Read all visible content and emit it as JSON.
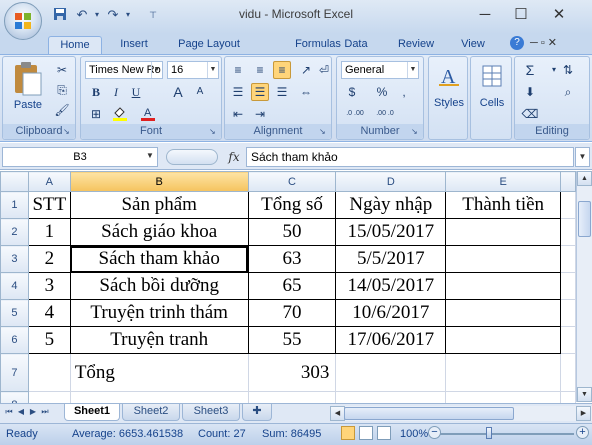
{
  "window": {
    "title": "vidu - Microsoft Excel",
    "minimize_glyph": "─",
    "maximize_glyph": "☐",
    "close_glyph": "✕"
  },
  "qat": {
    "save_icon": "save-icon",
    "undo_icon": "undo-icon",
    "redo_icon": "redo-icon",
    "customize_icon": "chevron-down-icon"
  },
  "tabs": [
    "Home",
    "Insert",
    "Page Layout",
    "Formulas",
    "Data",
    "Review",
    "View"
  ],
  "ribbon": {
    "clipboard": {
      "label": "Clipboard",
      "paste": "Paste"
    },
    "font": {
      "label": "Font",
      "name": "Times New Ro",
      "size": "16",
      "bold": "B",
      "italic": "I",
      "underline": "U",
      "grow": "A",
      "shrink": "A"
    },
    "alignment": {
      "label": "Alignment"
    },
    "number": {
      "label": "Number",
      "format": "General",
      "currency": "$",
      "percent": "%",
      "comma": ",",
      "dec_inc": ".0 .00",
      "dec_dec": ".00 .0"
    },
    "styles": {
      "label": "Styles"
    },
    "cells": {
      "label": "Cells"
    },
    "editing": {
      "label": "Editing",
      "sum": "Σ"
    }
  },
  "formula_bar": {
    "name_box": "B3",
    "fx": "fx",
    "formula": "Sách tham khảo"
  },
  "sheet": {
    "columns": [
      "A",
      "B",
      "C",
      "D",
      "E"
    ],
    "selected_column": "B",
    "row_numbers": [
      "1",
      "2",
      "3",
      "4",
      "5",
      "6",
      "7",
      "8"
    ],
    "header": [
      "STT",
      "Sản phẩm",
      "Tổng số",
      "Ngày nhập",
      "Thành tiền"
    ],
    "rows": [
      [
        "1",
        "Sách giáo khoa",
        "50",
        "15/05/2017",
        ""
      ],
      [
        "2",
        "Sách tham khảo",
        "63",
        "5/5/2017",
        ""
      ],
      [
        "3",
        "Sách bồi dưỡng",
        "65",
        "14/05/2017",
        ""
      ],
      [
        "4",
        "Truyện trinh thám",
        "70",
        "10/6/2017",
        ""
      ],
      [
        "5",
        "Truyện tranh",
        "55",
        "17/06/2017",
        ""
      ]
    ],
    "total_label": "Tổng",
    "total_value": "303",
    "active_cell": "B3"
  },
  "sheet_tabs": [
    "Sheet1",
    "Sheet2",
    "Sheet3"
  ],
  "active_sheet": "Sheet1",
  "status": {
    "mode": "Ready",
    "average": "Average: 6653.461538",
    "count": "Count: 27",
    "sum": "Sum: 86495",
    "zoom": "100%"
  },
  "colors": {
    "ribbon_bg": "#dbe6f4",
    "selected_header": "#f5c35e",
    "grid_line": "#d0d7e5"
  }
}
